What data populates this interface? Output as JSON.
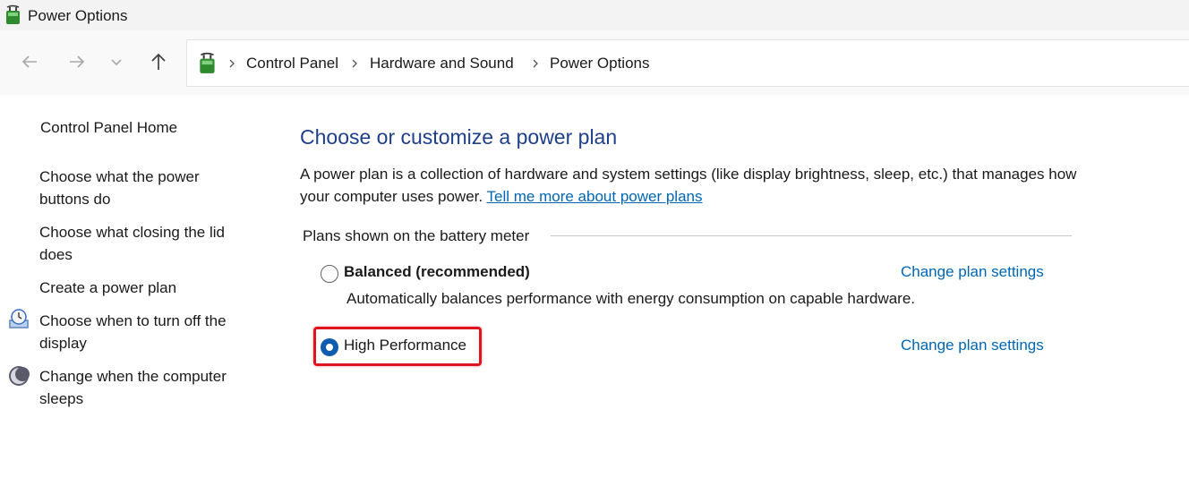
{
  "window": {
    "title": "Power Options",
    "accent_color": "#1e3f8c",
    "link_color": "#0066b4",
    "highlight_color": "#e0141e"
  },
  "nav": {
    "back_icon": "arrow-left-icon",
    "forward_icon": "arrow-right-icon",
    "recent_icon": "chevron-down-icon",
    "up_icon": "arrow-up-icon"
  },
  "breadcrumb": {
    "items": [
      "Control Panel",
      "Hardware and Sound",
      "Power Options"
    ],
    "icon": "power-options-icon"
  },
  "sidebar": {
    "home": "Control Panel Home",
    "items": [
      {
        "line1": "Choose what the power",
        "line2": "buttons do"
      },
      {
        "line1": "Choose what closing the lid",
        "line2": "does"
      },
      {
        "line1": "Create a power plan",
        "line2": ""
      },
      {
        "line1": "Choose when to turn off the",
        "line2": "display",
        "icon": "display-clock-icon"
      },
      {
        "line1": "Change when the computer",
        "line2": "sleeps",
        "icon": "moon-icon"
      }
    ]
  },
  "main": {
    "heading": "Choose or customize a power plan",
    "description": "A power plan is a collection of hardware and system settings (like display brightness, sleep, etc.) that manages how your computer uses power.",
    "learn_more": "Tell me more about power plans",
    "group_label": "Plans shown on the battery meter",
    "plans": [
      {
        "name": "Balanced (recommended)",
        "selected": false,
        "description": "Automatically balances performance with energy consumption on capable hardware.",
        "change_link": "Change plan settings"
      },
      {
        "name": "High Performance",
        "selected": true,
        "description": "",
        "change_link": "Change plan settings"
      }
    ]
  }
}
